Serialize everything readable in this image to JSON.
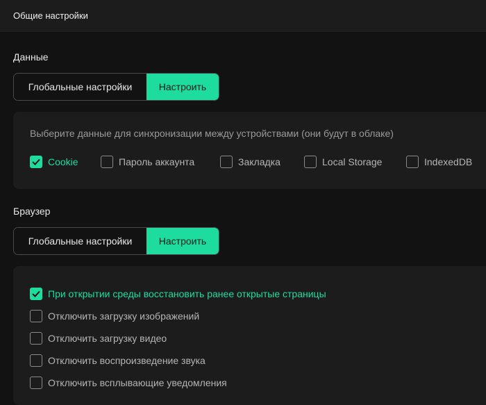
{
  "header": {
    "title": "Общие настройки"
  },
  "data_section": {
    "label": "Данные",
    "segment": {
      "global_label": "Глобальные настройки",
      "custom_label": "Настроить"
    },
    "hint": "Выберите данные для синхронизации между устройствами (они будут в облаке)",
    "options": [
      {
        "label": "Cookie",
        "checked": true
      },
      {
        "label": "Пароль аккаунта",
        "checked": false
      },
      {
        "label": "Закладка",
        "checked": false
      },
      {
        "label": "Local Storage",
        "checked": false
      },
      {
        "label": "IndexedDB",
        "checked": false
      }
    ]
  },
  "browser_section": {
    "label": "Браузер",
    "segment": {
      "global_label": "Глобальные настройки",
      "custom_label": "Настроить"
    },
    "options": [
      {
        "label": "При открытии среды восстановить ранее открытые страницы",
        "checked": true
      },
      {
        "label": "Отключить загрузку изображений",
        "checked": false
      },
      {
        "label": "Отключить загрузку видео",
        "checked": false
      },
      {
        "label": "Отключить воспроизведение звука",
        "checked": false
      },
      {
        "label": "Отключить всплывающие уведомления",
        "checked": false
      }
    ]
  },
  "colors": {
    "accent": "#1ddc9e",
    "background": "#121212",
    "panel": "#1c1c1c"
  }
}
